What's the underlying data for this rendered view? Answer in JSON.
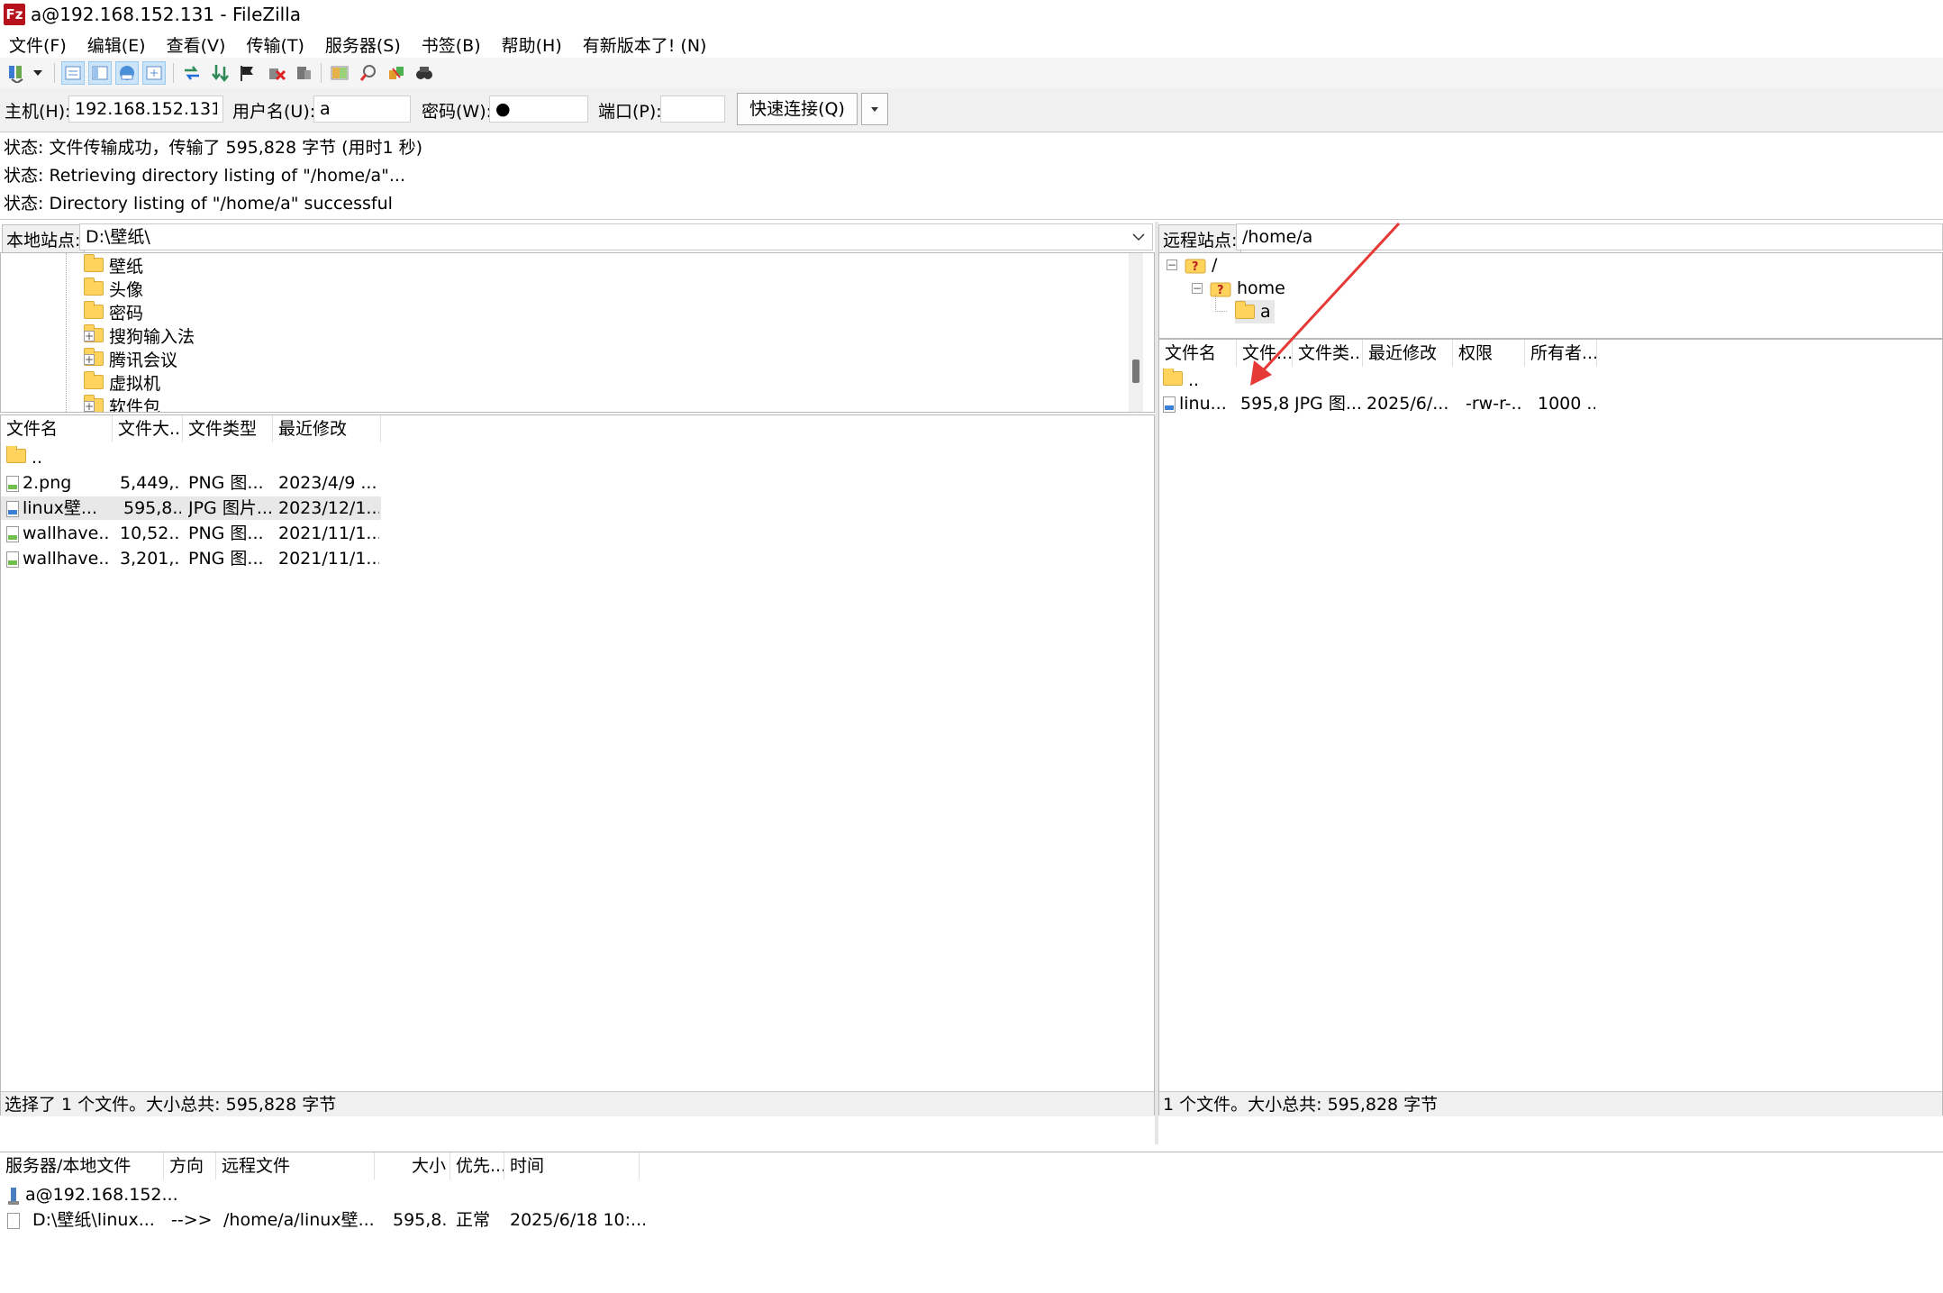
{
  "window": {
    "title": "a@192.168.152.131 - FileZilla",
    "logo": "Fz"
  },
  "menu": [
    "文件(F)",
    "编辑(E)",
    "查看(V)",
    "传输(T)",
    "服务器(S)",
    "书签(B)",
    "帮助(H)",
    "有新版本了! (N)"
  ],
  "toolbar": {
    "icons": [
      "site-manager-icon",
      "dropdown-arrow-icon",
      "toggle-log-icon",
      "toggle-local-tree-icon",
      "toggle-remote-tree-icon",
      "toggle-queue-icon",
      "refresh-icon",
      "process-queue-icon",
      "cancel-icon",
      "disconnect-icon",
      "reconnect-icon",
      "directory-compare-icon",
      "filter-icon",
      "sync-browse-icon",
      "search-icon"
    ]
  },
  "quickconnect": {
    "host_label": "主机(H):",
    "host_value": "192.168.152.131",
    "user_label": "用户名(U):",
    "user_value": "a",
    "pass_label": "密码(W):",
    "pass_value": "●",
    "port_label": "端口(P):",
    "port_value": "",
    "connect_label": "快速连接(Q)"
  },
  "log": [
    "状态: 文件传输成功，传输了 595,828 字节 (用时1 秒)",
    "状态: Retrieving directory listing of \"/home/a\"...",
    "状态: Directory listing of \"/home/a\" successful"
  ],
  "local": {
    "site_label": "本地站点:",
    "path": "D:\\壁纸\\",
    "tree": [
      {
        "label": "壁纸",
        "expandable": false
      },
      {
        "label": "头像",
        "expandable": false
      },
      {
        "label": "密码",
        "expandable": false
      },
      {
        "label": "搜狗输入法",
        "expandable": true
      },
      {
        "label": "腾讯会议",
        "expandable": true
      },
      {
        "label": "虚拟机",
        "expandable": false
      },
      {
        "label": "软件包",
        "expandable": true
      }
    ],
    "columns": [
      "文件名",
      "文件大...",
      "文件类型",
      "最近修改"
    ],
    "parent": "..",
    "files": [
      {
        "name": "2.png",
        "size": "5,449,...",
        "type": "PNG 图...",
        "modified": "2023/4/9 ...",
        "kind": "png"
      },
      {
        "name": "linux壁...",
        "size": "595,8...",
        "type": "JPG 图片...",
        "modified": "2023/12/1...",
        "kind": "jpg"
      },
      {
        "name": "wallhave...",
        "size": "10,52...",
        "type": "PNG 图...",
        "modified": "2021/11/1...",
        "kind": "png"
      },
      {
        "name": "wallhave...",
        "size": "3,201,...",
        "type": "PNG 图...",
        "modified": "2021/11/1...",
        "kind": "png"
      }
    ],
    "status": "选择了 1 个文件。大小总共: 595,828 字节"
  },
  "remote": {
    "site_label": "远程站点:",
    "path": "/home/a",
    "tree": [
      {
        "label": "/",
        "unknown": true
      },
      {
        "label": "home",
        "unknown": true
      },
      {
        "label": "a",
        "unknown": false
      }
    ],
    "columns": [
      "文件名",
      "文件...",
      "文件类...",
      "最近修改",
      "权限",
      "所有者..."
    ],
    "parent": "..",
    "files": [
      {
        "name": "linu...",
        "size": "595,8...",
        "type": "JPG 图...",
        "modified": "2025/6/...",
        "perms": "-rw-r-...",
        "owner": "1000 ...",
        "kind": "jpg"
      }
    ],
    "status": "1 个文件。大小总共: 595,828 字节"
  },
  "queue": {
    "columns": [
      "服务器/本地文件",
      "方向",
      "远程文件",
      "大小",
      "优先...",
      "时间"
    ],
    "server": "a@192.168.152...",
    "items": [
      {
        "local": "D:\\壁纸\\linux...",
        "direction": "-->>",
        "remote": "/home/a/linux壁...",
        "size": "595,8...",
        "priority": "正常",
        "time": "2025/6/18 10:..."
      }
    ]
  },
  "colors": {
    "annotation_arrow": "#e53935",
    "selected_row": "#e8e8e8"
  }
}
